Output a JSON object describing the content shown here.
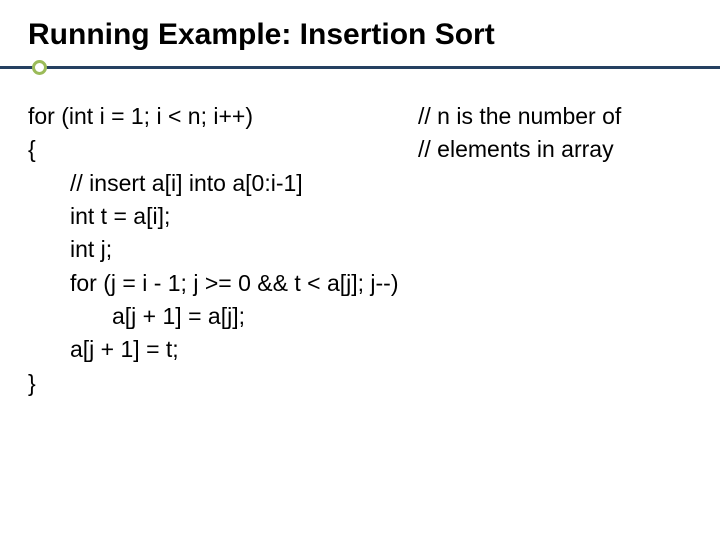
{
  "title": "Running Example: Insertion Sort",
  "code": {
    "line1_left": "for (int i = 1; i < n; i++)",
    "line1_right": "// n is the number of",
    "line2_left": "{",
    "line2_right": "// elements in array",
    "line3": "// insert a[i] into a[0:i-1]",
    "line4": "int t = a[i];",
    "line5": "int j;",
    "line6": "for (j = i - 1; j >= 0 && t < a[j]; j--)",
    "line7": "a[j + 1] = a[j];",
    "line8": "a[j + 1] = t;",
    "line9": "}"
  },
  "colors": {
    "rule": "#254061",
    "dot_border": "#9bbb59"
  }
}
